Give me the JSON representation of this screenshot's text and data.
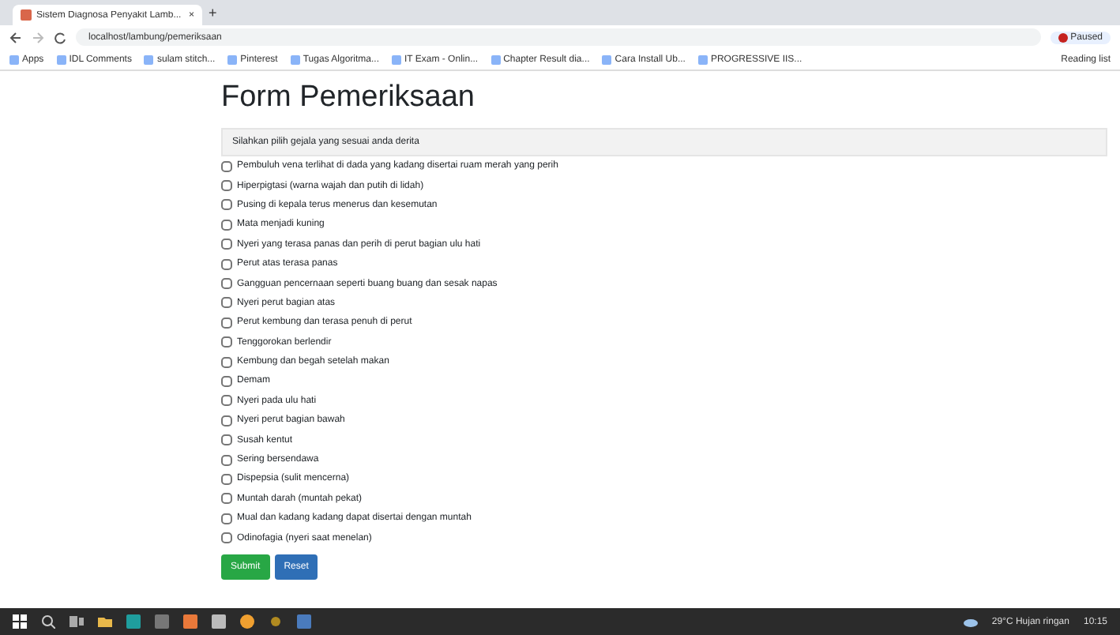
{
  "browser": {
    "tab_title": "Sistem Diagnosa Penyakit Lamb...",
    "tab_close": "×",
    "new_tab": "+",
    "url": "localhost/lambung/pemeriksaan",
    "profile": "Paused",
    "bookmarks": [
      "Apps",
      "IDL Comments",
      "sulam stitch...",
      "Pinterest",
      "Tugas Algoritma...",
      "IT Exam - Onlin...",
      "Chapter Result dia...",
      "Cara Install Ub...",
      "PROGRESSIVE IIS..."
    ],
    "reading_list": "Reading list"
  },
  "form": {
    "title": "Form Pemeriksaan",
    "instruction": "Silahkan pilih gejala yang sesuai anda derita",
    "symptoms": [
      {
        "label": "Pembuluh vena terlihat di dada yang kadang disertai ruam merah yang perih",
        "checked": false
      },
      {
        "label": "Hiperpigtasi (warna wajah dan putih di lidah)",
        "checked": false
      },
      {
        "label": "Pusing di kepala terus menerus dan kesemutan",
        "checked": false
      },
      {
        "label": "Mata menjadi kuning",
        "checked": false
      },
      {
        "label": "Nyeri yang terasa panas dan perih di perut bagian ulu hati",
        "checked": false
      },
      {
        "label": "Perut atas terasa panas",
        "checked": false
      },
      {
        "label": "Gangguan pencernaan seperti buang buang dan sesak napas",
        "checked": false
      },
      {
        "label": "Nyeri perut bagian atas",
        "checked": false
      },
      {
        "label": "Perut kembung dan terasa penuh di perut",
        "checked": false
      },
      {
        "label": "Tenggorokan berlendir",
        "checked": false
      },
      {
        "label": "Kembung dan begah setelah makan",
        "checked": false
      },
      {
        "label": "Demam",
        "checked": false
      },
      {
        "label": "Nyeri pada ulu hati",
        "checked": false
      },
      {
        "label": "Nyeri perut bagian bawah",
        "checked": false
      },
      {
        "label": "Susah kentut",
        "checked": false
      },
      {
        "label": "Sering bersendawa",
        "checked": false
      },
      {
        "label": "Dispepsia (sulit mencerna)",
        "checked": false
      },
      {
        "label": "Muntah darah (muntah pekat)",
        "checked": false
      },
      {
        "label": "Mual dan kadang kadang dapat disertai dengan muntah",
        "checked": false
      },
      {
        "label": "Odinofagia (nyeri saat menelan)",
        "checked": false
      }
    ],
    "buttons": [
      {
        "label": "Submit",
        "kind": "success"
      },
      {
        "label": "Reset",
        "kind": "primary"
      }
    ]
  },
  "taskbar": {
    "weather": "29°C Hujan ringan",
    "time": "10:15"
  }
}
